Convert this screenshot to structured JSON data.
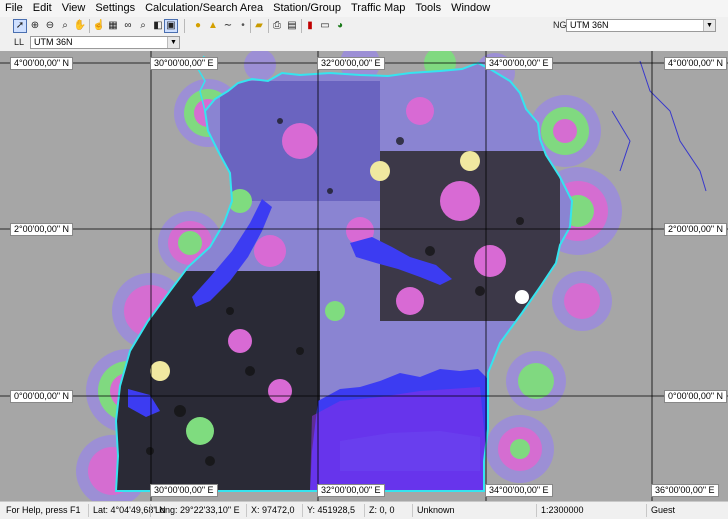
{
  "menu": [
    "File",
    "Edit",
    "View",
    "Settings",
    "Calculation/Search Area",
    "Station/Group",
    "Traffic Map",
    "Tools",
    "Window"
  ],
  "toolbar": {
    "icons": [
      "pointer-icon",
      "zoom-in-icon",
      "zoom-out-icon",
      "zoom-area-icon",
      "pan-hand-icon",
      "hand-icon",
      "map-icon",
      "binoculars-icon",
      "search-icon",
      "layers-icon",
      "image-icon",
      "circle-icon",
      "triangle-icon",
      "curve-icon",
      "dot-icon",
      "folder-icon",
      "print-icon",
      "print-preview-icon",
      "bar-chart-icon",
      "monitor-icon",
      "pie-chart-icon"
    ],
    "right_label": "NG",
    "projection_value": "UTM 36N"
  },
  "toolbar2": {
    "label": "LL",
    "projection_value": "UTM 36N"
  },
  "map": {
    "top_labels": [
      "30°00'00,00\" E",
      "32°00'00,00\" E",
      "34°00'00,00\" E"
    ],
    "bottom_labels": [
      "30°00'00,00\" E",
      "32°00'00,00\" E",
      "34°00'00,00\" E",
      "36°00'00,00\" E"
    ],
    "left_labels": [
      "4°00'00,00\" N",
      "2°00'00,00\" N",
      "0°00'00,00\" N"
    ],
    "right_labels": [
      "4°00'00,00\" N",
      "2°00'00,00\" N",
      "0°00'00,00\" N"
    ],
    "colors": {
      "background": "#a6a6a6",
      "land": "#8a84d2",
      "border": "#35e4ef",
      "lake": "#3c3cf2",
      "coverage_pink": "#d86ad4",
      "coverage_green": "#7fdc7f",
      "coverage_yellow": "#f0e8a0",
      "coverage_violet": "#9c8ed8"
    }
  },
  "status": {
    "help": "For Help, press F1",
    "lat": "Lat: 4°04'49,68\" N",
    "long": "Long: 29°22'33,10\" E",
    "x": "X: 97472,0",
    "y": "Y: 451928,5",
    "z": "Z: 0, 0",
    "unknown": "Unknown",
    "scale": "1:2300000",
    "user": "Guest"
  }
}
